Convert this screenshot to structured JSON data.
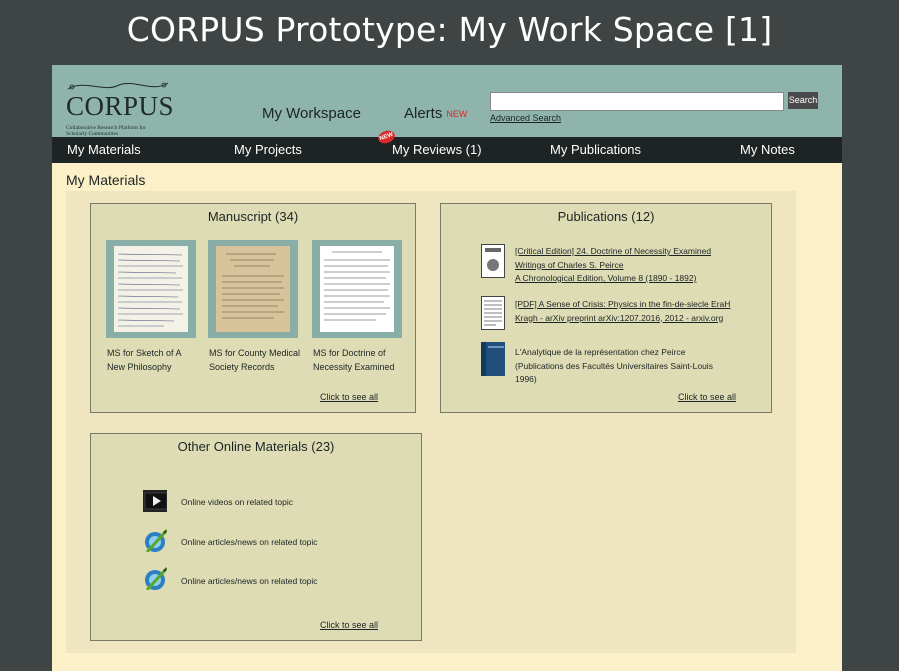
{
  "slide_title": "CORPUS Prototype:  My Work Space [1]",
  "header": {
    "logo_word": "CORPUS",
    "logo_tagline": "Collaborative Research Platform for Scholarly Communities",
    "tab_workspace": "My Workspace",
    "tab_alerts": "Alerts",
    "alerts_badge": "NEW",
    "search_value": "",
    "search_button": "Search",
    "advanced_search": "Advanced Search"
  },
  "nav": {
    "items": [
      "My Materials",
      "My Projects",
      "My Reviews (1)",
      "My Publications",
      "My Notes"
    ],
    "reviews_badge": "NEW"
  },
  "section_title": "My Materials",
  "manuscript": {
    "title": "Manuscript (34)",
    "items": [
      {
        "label": "MS for Sketch of A New Philosophy"
      },
      {
        "label": "MS for County Medical Society Records"
      },
      {
        "label": "MS for Doctrine of Necessity Examined"
      }
    ],
    "see_all": "Click to see all"
  },
  "publications": {
    "title": "Publications (12)",
    "items": [
      {
        "lines": [
          "[Critical Edition] 24. Doctrine of Necessity Examined",
          "Writings of Charles S. Peirce",
          "A Chronological Edition, Volume 8 (1890 - 1892)"
        ],
        "icon": "book-cover-icon"
      },
      {
        "lines": [
          "[PDF] A Sense of Crisis: Physics in the fin-de-siecle EraH",
          "Kragh - arXiv preprint arXiv:1207.2016, 2012 - arxiv.org"
        ],
        "icon": "pdf-document-icon"
      },
      {
        "lines": [
          "L'Analytique de la représentation chez Peirce",
          "(Publications des Facultés Universitaires Saint-Louis",
          "1996)"
        ],
        "icon": "blue-book-icon"
      }
    ],
    "see_all": "Click to see all"
  },
  "other": {
    "title": "Other Online Materials (23)",
    "items": [
      {
        "label": "Online videos on related topic",
        "icon": "video-icon"
      },
      {
        "label": "Online articles/news on related topic",
        "icon": "article-pen-icon"
      },
      {
        "label": "Online articles/news on related topic",
        "icon": "article-pen-icon"
      }
    ],
    "see_all": "Click to see all"
  }
}
